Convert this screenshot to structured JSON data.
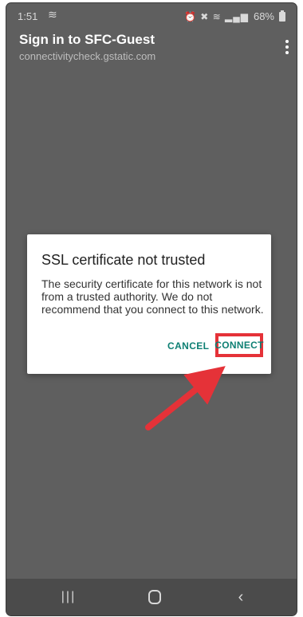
{
  "status_bar": {
    "time": "1:51",
    "right_icons": "⏰ ✖ WiFi",
    "battery_percent": "68%"
  },
  "header": {
    "title": "Sign in to SFC-Guest",
    "subtitle": "connectivitycheck.gstatic.com"
  },
  "dialog": {
    "title": "SSL certificate not trusted",
    "message": "The security certificate for this network is not from a trusted authority. We do not recommend that you connect to this network.",
    "cancel_label": "CANCEL",
    "connect_label": "CONNECT"
  },
  "colors": {
    "accent": "#0d7f73",
    "highlight": "#e53238",
    "background": "#5f5f5f"
  },
  "icons": {
    "menu": "more-vert-icon",
    "wifi": "wifi-icon",
    "battery": "battery-icon",
    "nav_recents": "recents-icon",
    "nav_home": "home-icon",
    "nav_back": "back-icon"
  }
}
